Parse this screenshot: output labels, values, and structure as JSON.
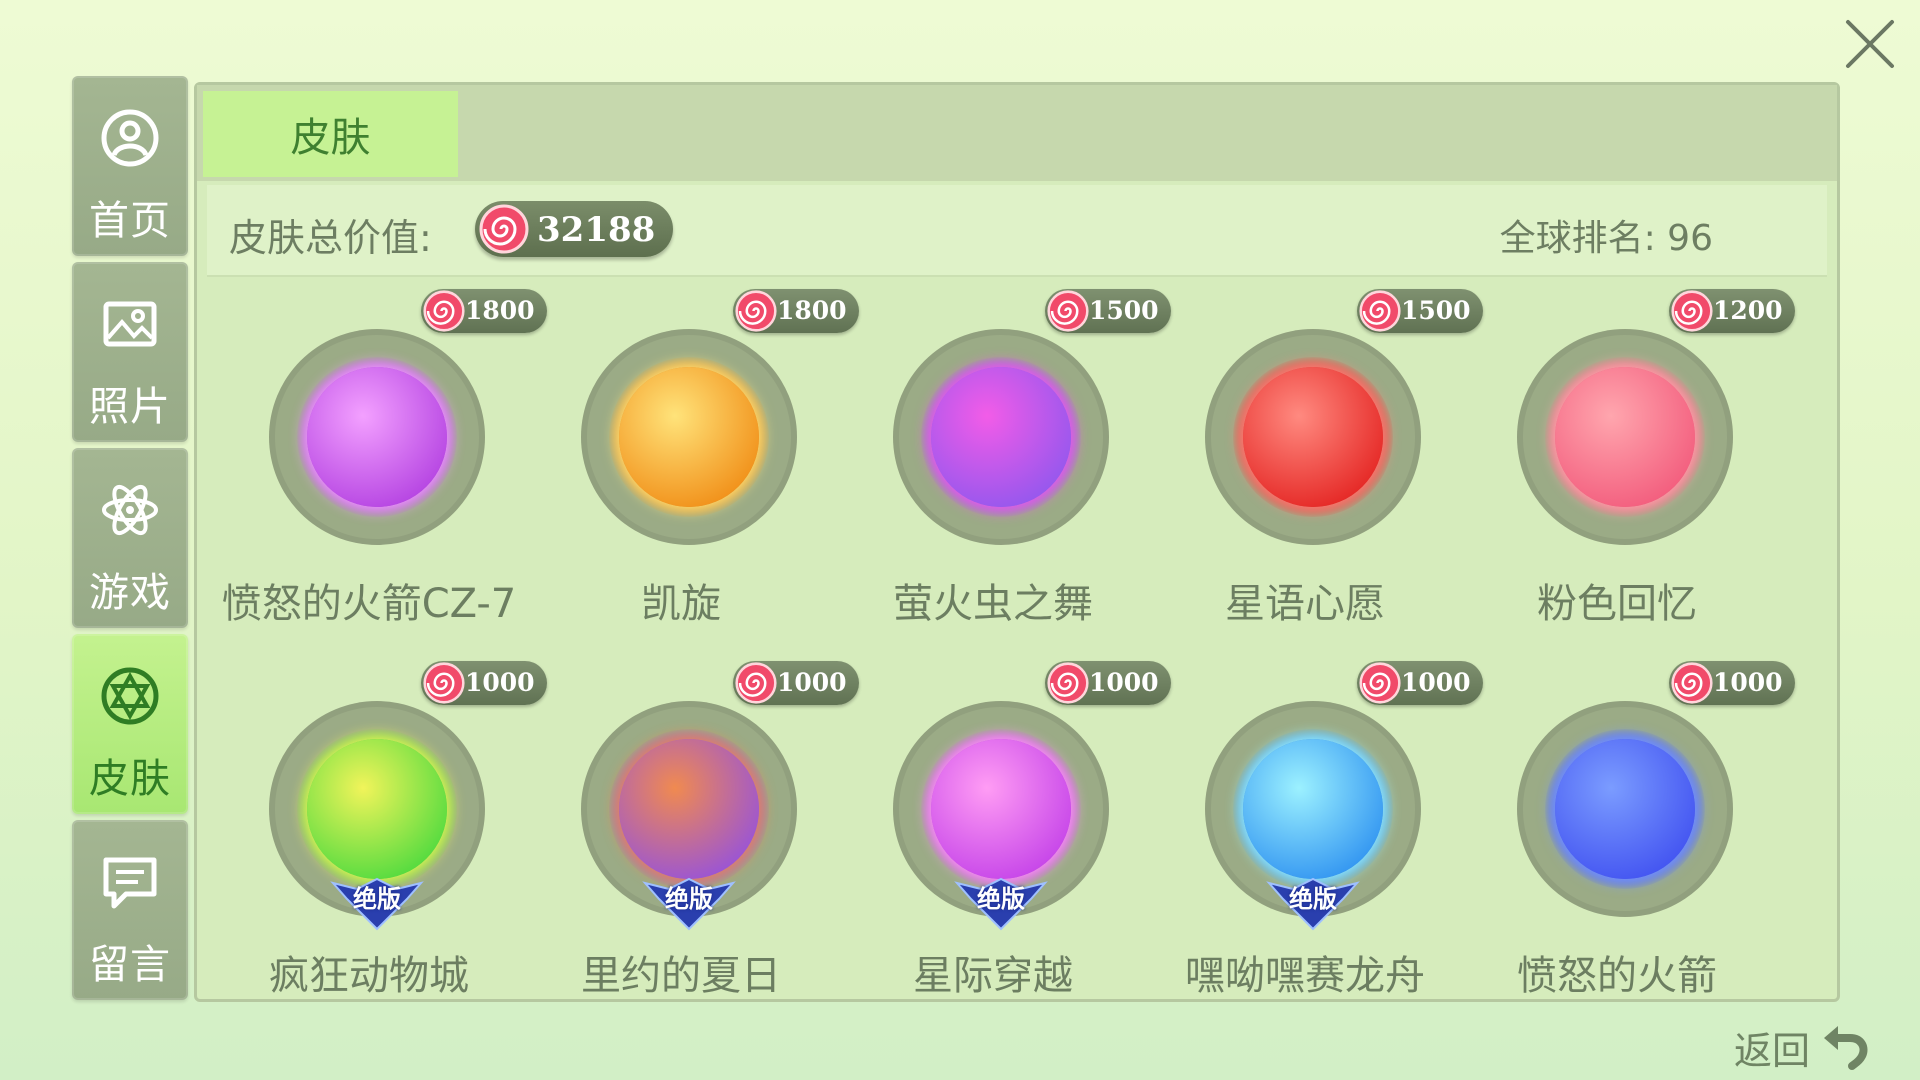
{
  "close": {
    "icon": "close-icon"
  },
  "sidebar": {
    "items": [
      {
        "label": "首页",
        "icon": "user-icon",
        "active": false
      },
      {
        "label": "照片",
        "icon": "picture-icon",
        "active": false
      },
      {
        "label": "游戏",
        "icon": "atom-icon",
        "active": false
      },
      {
        "label": "皮肤",
        "icon": "star-badge-icon",
        "active": true
      },
      {
        "label": "留言",
        "icon": "message-icon",
        "active": false
      }
    ]
  },
  "tabs": {
    "skin": "皮肤"
  },
  "info": {
    "value_label": "皮肤总价值:",
    "total_value": "32188",
    "rank": "全球排名: 96"
  },
  "skins": [
    {
      "name": "愤怒的火箭CZ-7",
      "price": "1800",
      "colors": [
        "#f3a0ff",
        "#b13ee0"
      ],
      "limited": false
    },
    {
      "name": "凯旋",
      "price": "1800",
      "colors": [
        "#ffe37a",
        "#f08a12"
      ],
      "limited": false
    },
    {
      "name": "萤火虫之舞",
      "price": "1500",
      "colors": [
        "#f25ce8",
        "#8e57ee"
      ],
      "limited": false
    },
    {
      "name": "星语心愿",
      "price": "1500",
      "colors": [
        "#ff8a80",
        "#e3201e"
      ],
      "limited": false
    },
    {
      "name": "粉色回忆",
      "price": "1200",
      "colors": [
        "#ffa6ae",
        "#f2587a"
      ],
      "limited": false
    },
    {
      "name": "疯狂动物城",
      "price": "1000",
      "colors": [
        "#f1f45a",
        "#47d93d"
      ],
      "limited": true
    },
    {
      "name": "里约的夏日",
      "price": "1000",
      "colors": [
        "#f08a50",
        "#9350e0"
      ],
      "limited": true
    },
    {
      "name": "星际穿越",
      "price": "1000",
      "colors": [
        "#ff9cf4",
        "#c23fe8"
      ],
      "limited": true
    },
    {
      "name": "嘿呦嘿赛龙舟",
      "price": "1000",
      "colors": [
        "#9cf1ff",
        "#2b8ff0"
      ],
      "limited": true
    },
    {
      "name": "愤怒的火箭",
      "price": "1000",
      "colors": [
        "#7b9cff",
        "#3f4ff0"
      ],
      "limited": false
    }
  ],
  "limited_label": "绝版",
  "back": {
    "label": "返回",
    "icon": "back-arrow-icon"
  }
}
